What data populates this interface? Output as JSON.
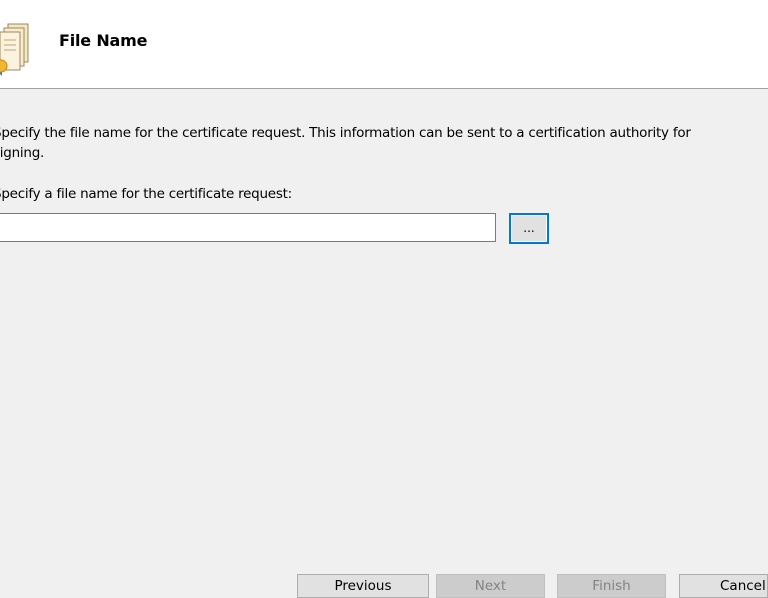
{
  "header": {
    "title": "File Name",
    "icon": "certificate-icon"
  },
  "main": {
    "description_line1": "Specify the file name for the certificate request. This information can be sent to a certification authority for",
    "description_line2": "signing.",
    "field_label": "Specify a file name for the certificate request:",
    "filename_value": "",
    "browse_label": "..."
  },
  "footer": {
    "previous_label": "Previous",
    "next_label": "Next",
    "finish_label": "Finish",
    "cancel_label": "Cancel"
  },
  "colors": {
    "focus_border": "#0078d7",
    "dialog_background": "#f0f0f0",
    "header_background": "#ffffff"
  }
}
